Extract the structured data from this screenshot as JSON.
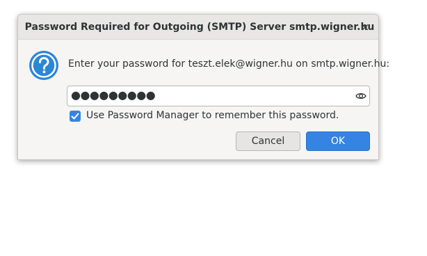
{
  "dialog": {
    "title": "Password Required for Outgoing (SMTP) Server smtp.wigner.hu",
    "close_label": "×",
    "prompt": "Enter your password for teszt.elek@wigner.hu on smtp.wigner.hu:",
    "password_masked": "●●●●●●●●●",
    "remember_label": "Use Password Manager to remember this password.",
    "remember_checked": true,
    "cancel_label": "Cancel",
    "ok_label": "OK"
  },
  "icons": {
    "dialog_icon": "question-icon",
    "reveal_icon": "eye-icon",
    "check_icon": "checkmark-icon",
    "close_icon": "close-icon"
  },
  "colors": {
    "accent": "#3584e4",
    "question_icon": "#2b86d5",
    "text": "#2e3436"
  }
}
